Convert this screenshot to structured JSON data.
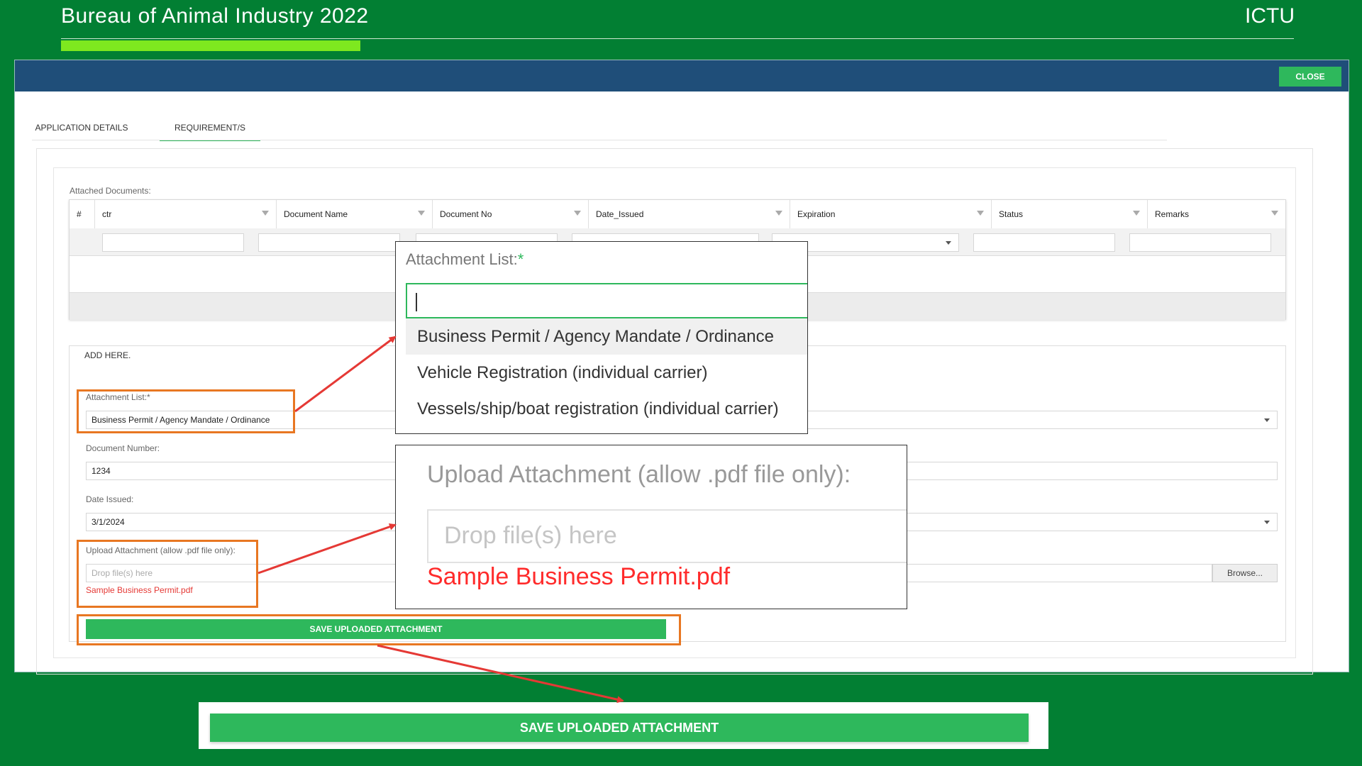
{
  "slide": {
    "title": "Bureau of Animal Industry 2022",
    "tag": "ICTU"
  },
  "window": {
    "close_label": "CLOSE"
  },
  "tabs": [
    {
      "label": "APPLICATION DETAILS"
    },
    {
      "label": "REQUIREMENT/S"
    }
  ],
  "grid": {
    "caption": "Attached Documents:",
    "columns": [
      "#",
      "ctr",
      "Document Name",
      "Document No",
      "Date_Issued",
      "Expiration",
      "Status",
      "Remarks"
    ]
  },
  "form": {
    "legend": "ADD HERE.",
    "attachment_label": "Attachment List:*",
    "attachment_value": "Business Permit / Agency Mandate / Ordinance",
    "docnum_label": "Document Number:",
    "docnum_value": "1234",
    "date_label": "Date Issued:",
    "date_value": "3/1/2024",
    "upload_label": "Upload Attachment (allow .pdf file only):",
    "drop_placeholder": "Drop file(s) here",
    "file_name": "Sample Business Permit.pdf",
    "browse_label": "Browse...",
    "save_label": "SAVE UPLOADED ATTACHMENT"
  },
  "zoom_dropdown": {
    "label": "Attachment List:",
    "required_mark": "*",
    "options": [
      "Business Permit / Agency Mandate / Ordinance",
      "Vehicle Registration (individual carrier)",
      "Vessels/ship/boat registration (individual carrier)"
    ]
  },
  "zoom_upload": {
    "label": "Upload Attachment (allow .pdf file only):",
    "drop_placeholder": "Drop file(s) here",
    "file_name": "Sample Business Permit.pdf"
  },
  "zoom_save": {
    "label": "SAVE UPLOADED ATTACHMENT"
  },
  "colors": {
    "background": "#027f33",
    "header": "#1f4e79",
    "save_green": "#2eb85c",
    "highlight": "#e87722",
    "arrow": "#e53935",
    "lime": "#7ee81f"
  }
}
